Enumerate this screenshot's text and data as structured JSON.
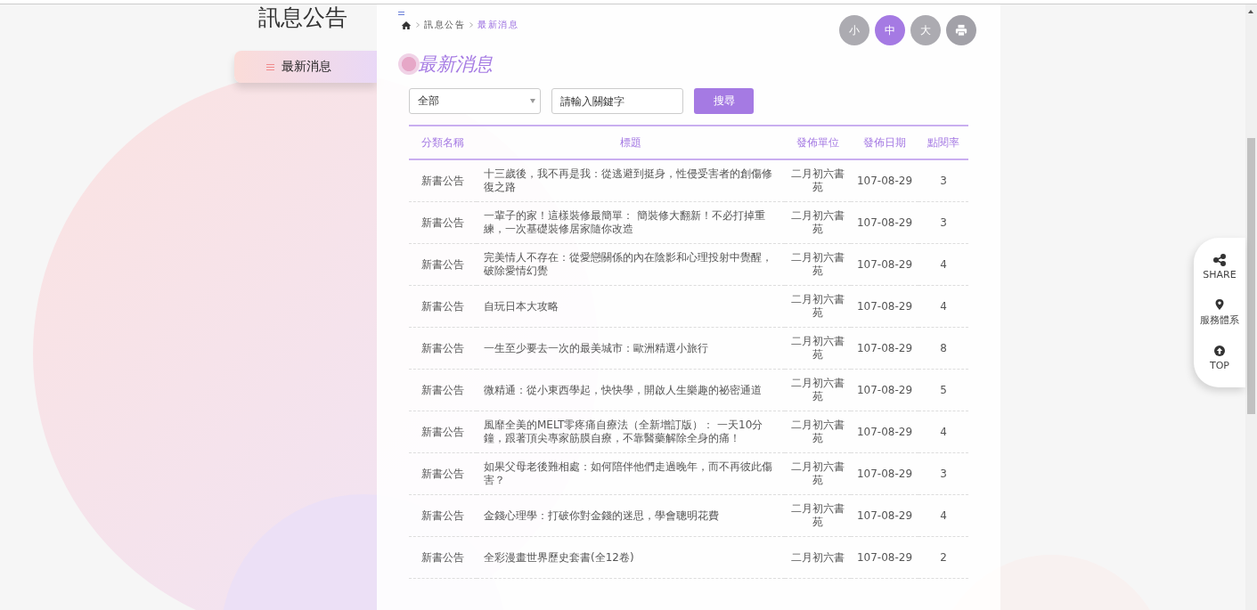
{
  "sidebar": {
    "title": "訊息公告",
    "items": [
      {
        "label": "最新消息",
        "selected": true
      }
    ]
  },
  "breadcrumb": [
    {
      "label": "訊息公告",
      "current": false
    },
    {
      "label": "最新消息",
      "current": true
    }
  ],
  "font_size_buttons": [
    {
      "label": "小",
      "selected": false
    },
    {
      "label": "中",
      "selected": true
    },
    {
      "label": "大",
      "selected": false
    }
  ],
  "heading": "最新消息",
  "filter": {
    "category": "全部",
    "keyword_placeholder": "請輸入關鍵字",
    "search_button": "搜尋"
  },
  "table": {
    "columns": [
      "分類名稱",
      "標題",
      "發佈單位",
      "發佈日期",
      "點閱率"
    ],
    "rows": [
      {
        "category": "新書公告",
        "title": "十三歲後，我不再是我：從逃避到挺身，性侵受害者的創傷修復之路",
        "unit": "二月初六書苑",
        "date": "107-08-29",
        "clicks": "3"
      },
      {
        "category": "新書公告",
        "title": "一輩子的家！這樣裝修最簡單： 簡裝修大翻新！不必打掉重練，一次基礎裝修居家隨你改造",
        "unit": "二月初六書苑",
        "date": "107-08-29",
        "clicks": "3"
      },
      {
        "category": "新書公告",
        "title": "完美情人不存在：從愛戀關係的內在陰影和心理投射中覺醒，破除愛情幻覺",
        "unit": "二月初六書苑",
        "date": "107-08-29",
        "clicks": "4"
      },
      {
        "category": "新書公告",
        "title": "自玩日本大攻略",
        "unit": "二月初六書苑",
        "date": "107-08-29",
        "clicks": "4"
      },
      {
        "category": "新書公告",
        "title": "一生至少要去一次的最美城市：歐洲精選小旅行",
        "unit": "二月初六書苑",
        "date": "107-08-29",
        "clicks": "8"
      },
      {
        "category": "新書公告",
        "title": "微精通：從小東西學起，快快學，開啟人生樂趣的祕密通道",
        "unit": "二月初六書苑",
        "date": "107-08-29",
        "clicks": "5"
      },
      {
        "category": "新書公告",
        "title": "風靡全美的MELT零疼痛自療法（全新增訂版）： 一天10分鐘，跟著頂尖專家筋膜自療，不靠醫藥解除全身的痛！",
        "unit": "二月初六書苑",
        "date": "107-08-29",
        "clicks": "4"
      },
      {
        "category": "新書公告",
        "title": "如果父母老後難相處：如何陪伴他們走過晚年，而不再彼此傷害？",
        "unit": "二月初六書苑",
        "date": "107-08-29",
        "clicks": "3"
      },
      {
        "category": "新書公告",
        "title": "金錢心理學：打破你對金錢的迷思，學會聰明花費",
        "unit": "二月初六書苑",
        "date": "107-08-29",
        "clicks": "4"
      },
      {
        "category": "新書公告",
        "title": "全彩漫畫世界歷史套書(全12卷)",
        "unit": "二月初六書",
        "date": "107-08-29",
        "clicks": "2"
      }
    ]
  },
  "side_tools": [
    {
      "kind": "share",
      "label": "SHARE"
    },
    {
      "kind": "location",
      "label": "服務體系"
    },
    {
      "kind": "top",
      "label": "TOP"
    }
  ]
}
